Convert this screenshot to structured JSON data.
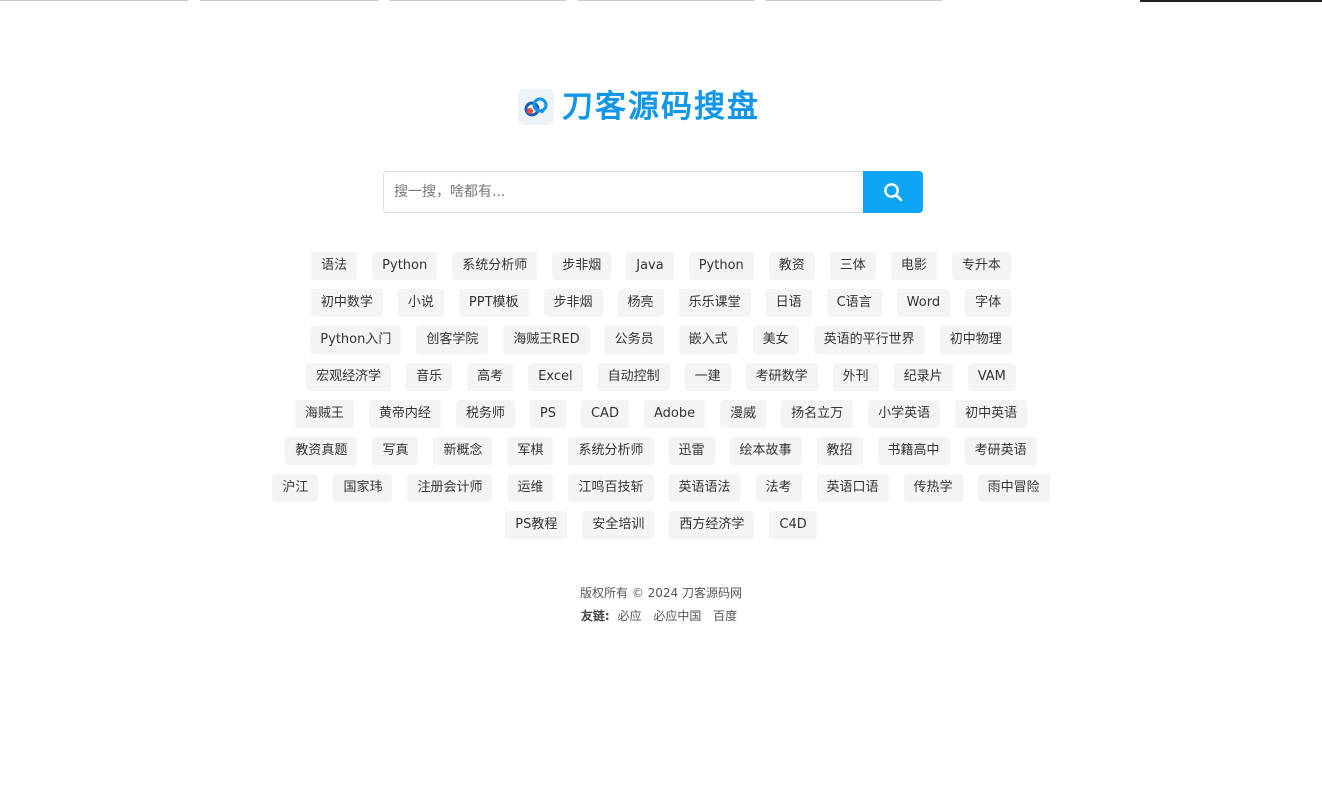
{
  "site": {
    "title": "刀客源码搜盘"
  },
  "search": {
    "placeholder": "搜一搜，啥都有..."
  },
  "tag_rows": [
    [
      "语法",
      "Python",
      "系统分析师",
      "步非烟",
      "Java",
      "Python",
      "教资",
      "三体",
      "电影",
      "专升本"
    ],
    [
      "初中数学",
      "小说",
      "PPT模板",
      "步非烟",
      "杨亮",
      "乐乐课堂",
      "日语",
      "C语言",
      "Word",
      "字体"
    ],
    [
      "Python入门",
      "创客学院",
      "海贼王RED",
      "公务员",
      "嵌入式",
      "美女",
      "英语的平行世界",
      "初中物理"
    ],
    [
      "宏观经济学",
      "音乐",
      "高考",
      "Excel",
      "自动控制",
      "一建",
      "考研数学",
      "外刊",
      "纪录片",
      "VAM"
    ],
    [
      "海贼王",
      "黄帝内经",
      "税务师",
      "PS",
      "CAD",
      "Adobe",
      "漫威",
      "扬名立万",
      "小学英语",
      "初中英语"
    ],
    [
      "教资真题",
      "写真",
      "新概念",
      "军棋",
      "系统分析师",
      "迅雷",
      "绘本故事",
      "教招",
      "书籍高中",
      "考研英语"
    ],
    [
      "沪江",
      "国家玮",
      "注册会计师",
      "运维",
      "江鸣百技斩",
      "英语语法",
      "法考",
      "英语口语",
      "传热学",
      "雨中冒险"
    ],
    [
      "PS教程",
      "安全培训",
      "西方经济学",
      "C4D"
    ]
  ],
  "footer": {
    "copyright": "版权所有 © 2024 刀客源码网",
    "links_label": "友链:",
    "links": [
      "必应",
      "必应中国",
      "百度"
    ]
  },
  "colors": {
    "brand": "#1197e6",
    "search_button": "#0ea5f5",
    "tag_bg": "#f4f4f4"
  }
}
